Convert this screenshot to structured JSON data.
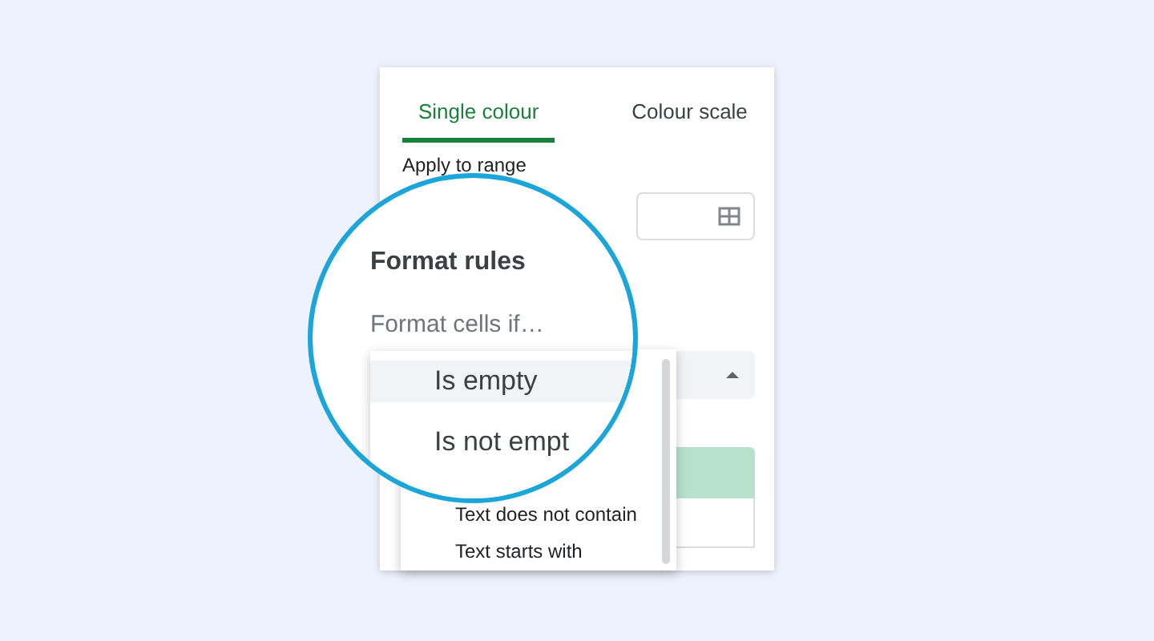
{
  "tabs": [
    {
      "label": "Single colour",
      "selected": true
    },
    {
      "label": "Colour scale",
      "selected": false
    }
  ],
  "range_label": "Apply to range",
  "dropdown_menu": {
    "items": [
      {
        "label": "Text does not contain"
      },
      {
        "label": "Text starts with"
      }
    ]
  },
  "magnifier": {
    "heading": "Format rules",
    "condition_label": "Format cells if…",
    "items": [
      {
        "label": "Is empty",
        "selected": true
      },
      {
        "label": "Is not empt",
        "selected": false
      }
    ]
  }
}
